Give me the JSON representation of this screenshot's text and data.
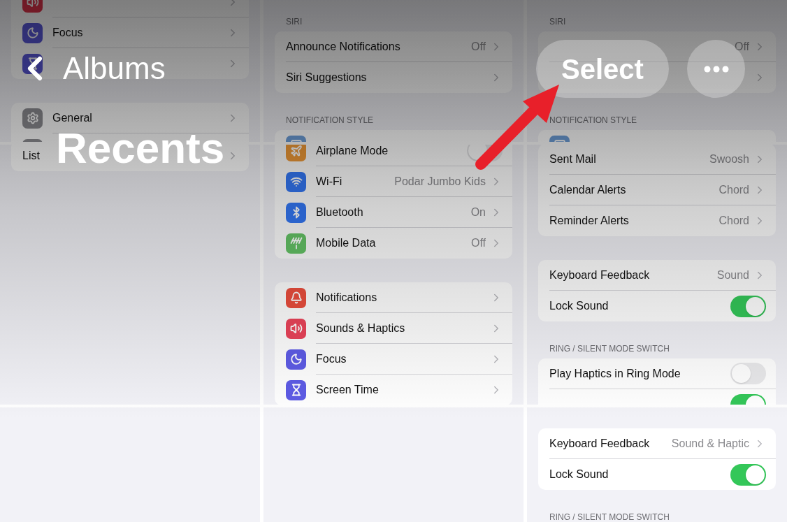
{
  "nav": {
    "back": "Albums",
    "title": "Recents",
    "select": "Select"
  },
  "tiles": [
    {
      "kind": "settings",
      "blocks": [
        {
          "kind": "group",
          "rows": [
            {
              "kind": "link"
            },
            {
              "kind": "link",
              "label": "Focus"
            },
            {
              "kind": "link"
            }
          ]
        },
        {
          "kind": "group",
          "rows": [
            {
              "kind": "link",
              "label": "General"
            },
            {
              "kind": "cut"
            }
          ]
        }
      ]
    },
    {
      "kind": "settings",
      "blocks": [
        {
          "kind": "header",
          "text": "SIRI"
        },
        {
          "kind": "group",
          "rows": [
            {
              "kind": "link",
              "label": "Announce Notifications",
              "value": "Off"
            },
            {
              "kind": "link",
              "label": "Siri Suggestions"
            }
          ]
        },
        {
          "kind": "header",
          "text": "NOTIFICATION STYLE"
        },
        {
          "kind": "group",
          "rows": [
            {
              "kind": "cut"
            }
          ]
        }
      ]
    },
    {
      "kind": "settings",
      "blocks": [
        {
          "kind": "header",
          "text": "SIRI"
        },
        {
          "kind": "group",
          "rows": [
            {
              "kind": "link",
              "value": "Off"
            },
            {
              "kind": "link"
            }
          ]
        },
        {
          "kind": "header",
          "text": "NOTIFICATION STYLE"
        },
        {
          "kind": "group",
          "rows": [
            {
              "kind": "cut"
            }
          ]
        }
      ]
    },
    {
      "kind": "settings",
      "blocks": [
        {
          "kind": "group",
          "rows": [
            {
              "kind": "link",
              "label": "List"
            }
          ]
        }
      ]
    },
    {
      "kind": "settings",
      "blocks": [
        {
          "kind": "group",
          "rows": [
            {
              "kind": "toggle",
              "label": "Airplane Mode",
              "on": false
            },
            {
              "kind": "link",
              "label": "Wi-Fi",
              "value": "Podar Jumbo Kids"
            },
            {
              "kind": "link",
              "label": "Bluetooth",
              "value": "On"
            },
            {
              "kind": "link",
              "label": "Mobile Data",
              "value": "Off"
            }
          ]
        },
        {
          "kind": "group",
          "rows": [
            {
              "kind": "link",
              "label": "Notifications"
            },
            {
              "kind": "link",
              "label": "Sounds & Haptics"
            },
            {
              "kind": "link",
              "label": "Focus"
            },
            {
              "kind": "link",
              "label": "Screen Time"
            }
          ]
        }
      ]
    },
    {
      "kind": "settings",
      "blocks": [
        {
          "kind": "group",
          "rows": [
            {
              "kind": "link",
              "label": "Sent Mail",
              "value": "Swoosh"
            },
            {
              "kind": "link",
              "label": "Calendar Alerts",
              "value": "Chord"
            },
            {
              "kind": "link",
              "label": "Reminder Alerts",
              "value": "Chord"
            }
          ]
        },
        {
          "kind": "group",
          "rows": [
            {
              "kind": "link",
              "label": "Keyboard Feedback",
              "value": "Sound"
            },
            {
              "kind": "toggle",
              "label": "Lock Sound",
              "on": true
            }
          ]
        },
        {
          "kind": "header",
          "text": "RING / SILENT MODE SWITCH"
        },
        {
          "kind": "group",
          "rows": [
            {
              "kind": "toggle",
              "label": "Play Haptics in Ring Mode",
              "on": false
            },
            {
              "kind": "toggle",
              "on": true
            }
          ]
        }
      ]
    },
    {
      "kind": "blank"
    },
    {
      "kind": "blank"
    },
    {
      "kind": "settings",
      "blocks": [
        {
          "kind": "group",
          "rows": [
            {
              "kind": "link",
              "label": "Keyboard Feedback",
              "value": "Sound & Haptic"
            },
            {
              "kind": "toggle",
              "label": "Lock Sound",
              "on": true
            }
          ]
        },
        {
          "kind": "header",
          "text": "RING / SILENT MODE SWITCH"
        }
      ]
    }
  ]
}
